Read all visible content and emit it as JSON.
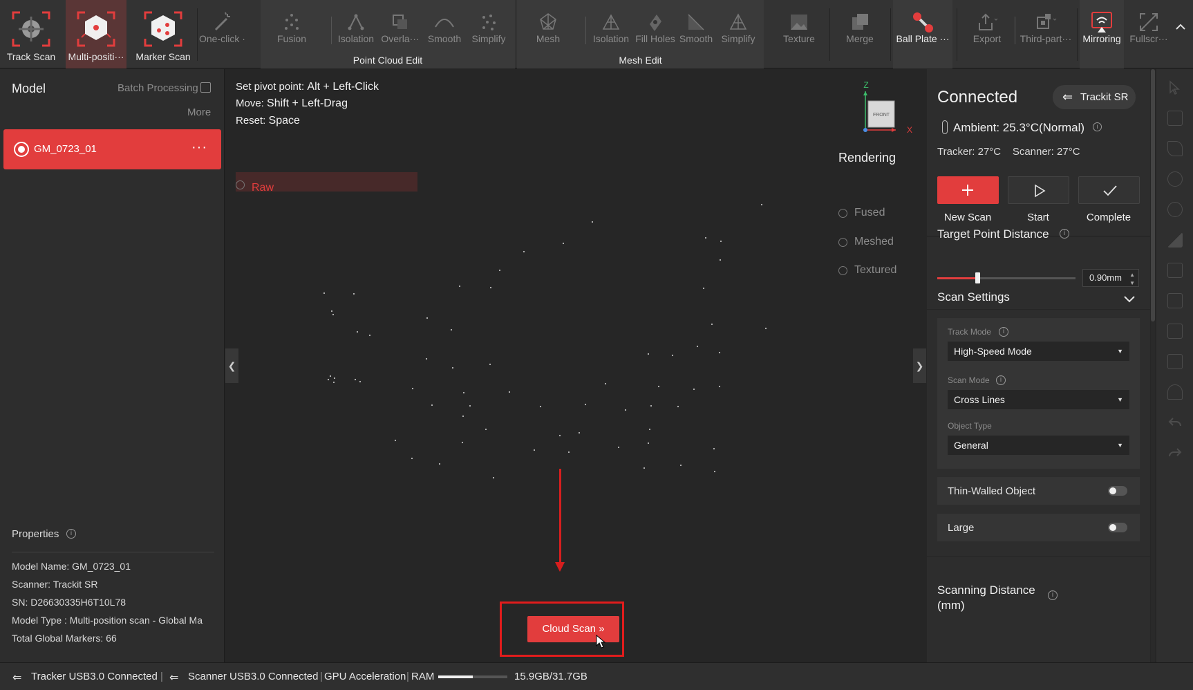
{
  "toolbar": {
    "modes": [
      {
        "label": "Track Scan",
        "icon": "track-scan-icon"
      },
      {
        "label": "Multi-positi···",
        "icon": "multi-position-scan-icon"
      },
      {
        "label": "Marker Scan",
        "icon": "marker-scan-icon"
      }
    ],
    "one_click": "One-click ···",
    "pc_tools": [
      "Fusion",
      "Isolation",
      "Overla···",
      "Smooth",
      "Simplify"
    ],
    "pc_group": "Point Cloud Edit",
    "mesh_tools": [
      "Mesh",
      "Isolation",
      "Fill Holes",
      "Smooth",
      "Simplify"
    ],
    "mesh_group": "Mesh Edit",
    "texture": "Texture",
    "merge": "Merge",
    "ball_plate": "Ball Plate ···",
    "export": "Export",
    "third_party": "Third-part···",
    "mirroring": "Mirroring",
    "fullscreen": "Fullscr···",
    "accent": "#e23d3d"
  },
  "left": {
    "title": "Model",
    "batch": "Batch Processing",
    "more": "More",
    "model_name": "GM_0723_01",
    "item_dots": "···",
    "properties_title": "Properties",
    "properties": [
      {
        "k": "Model Name:",
        "v": "GM_0723_01"
      },
      {
        "k": "Scanner:",
        "v": "Trackit SR"
      },
      {
        "k": "SN:",
        "v": "D26630335H6T10L78"
      },
      {
        "k": "Model Type :",
        "v": "Multi-position scan - Global Ma"
      },
      {
        "k": "Total Global Markers:",
        "v": "66"
      }
    ]
  },
  "viewport": {
    "hints": [
      {
        "k": "Set pivot point:",
        "v": "Alt + Left-Click"
      },
      {
        "k": "Move:",
        "v": "Shift + Left-Drag"
      },
      {
        "k": "Reset:",
        "v": "Space"
      }
    ],
    "axis_z": "Z",
    "axis_x": "X",
    "cube_face": "FRONT",
    "rendering_title": "Rendering",
    "render_options": [
      "Raw",
      "Fused",
      "Meshed",
      "Textured"
    ],
    "render_selected": "Raw",
    "cloud_scan": "Cloud Scan"
  },
  "right": {
    "status": "Connected",
    "device": "Trackit SR",
    "ambient": "Ambient: 25.3°C(Normal)",
    "tracker_temp": "Tracker: 27°C",
    "scanner_temp": "Scanner: 27°C",
    "new_scan": "New Scan",
    "start": "Start",
    "complete": "Complete",
    "target_title": "Target Point Distance",
    "target_value": "0.90mm",
    "target_level": 0.29,
    "scan_settings": "Scan Settings",
    "track_mode_label": "Track Mode",
    "track_mode": "High-Speed Mode",
    "scan_mode_label": "Scan Mode",
    "scan_mode": "Cross Lines",
    "object_type_label": "Object Type",
    "object_type": "General",
    "thin_walled": "Thin-Walled Object",
    "large": "Large",
    "scanning_distance": "Scanning Distance (mm)"
  },
  "status": {
    "tracker": "Tracker USB3.0 Connected",
    "scanner": "Scanner USB3.0 Connected",
    "gpu": "GPU Acceleration",
    "ram_label": "RAM",
    "ram": "15.9GB/31.7GB",
    "ram_fraction": 0.5
  }
}
